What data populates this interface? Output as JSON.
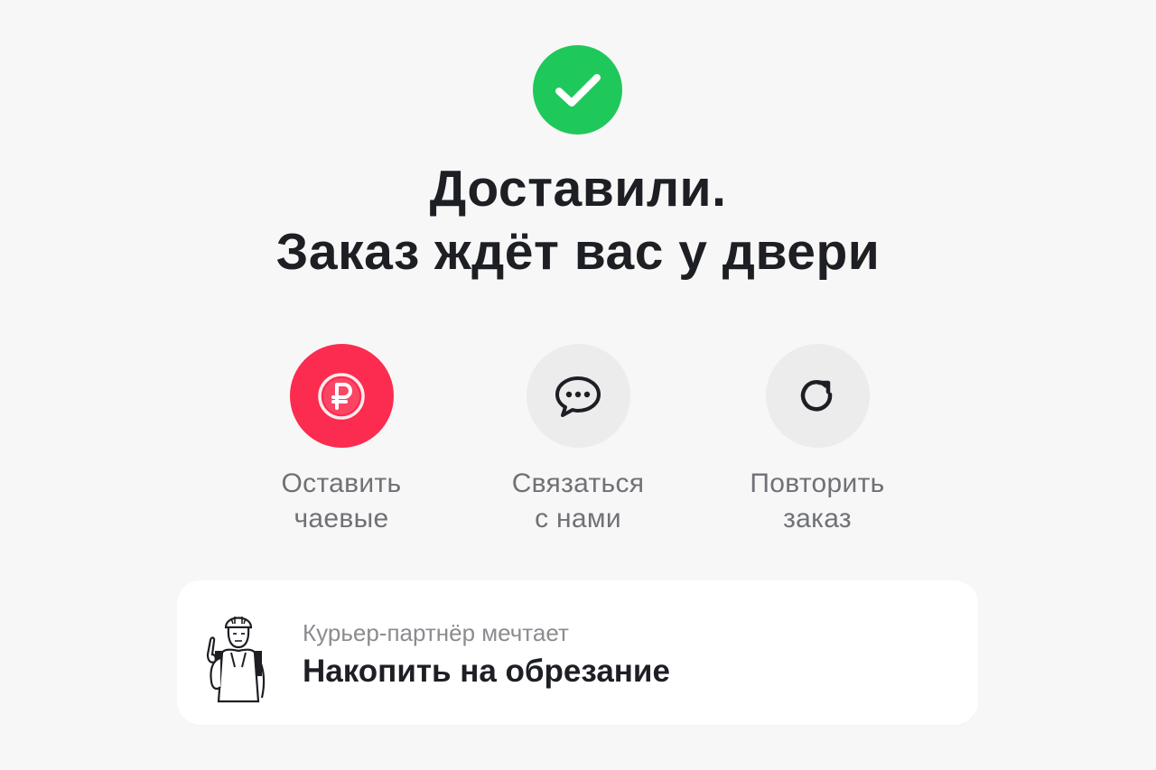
{
  "status": {
    "icon": "checkmark-icon",
    "color": "#1fc85a"
  },
  "headline": {
    "line1": "Доставили.",
    "line2": "Заказ ждёт вас у двери"
  },
  "actions": [
    {
      "icon": "ruble-coin-icon",
      "line1": "Оставить",
      "line2": "чаевые",
      "accent": "#fb2c4f"
    },
    {
      "icon": "chat-bubble-icon",
      "line1": "Связаться",
      "line2": "с нами"
    },
    {
      "icon": "repeat-icon",
      "line1": "Повторить",
      "line2": "заказ"
    }
  ],
  "dream_card": {
    "caption": "Курьер-партнёр мечтает",
    "dream": "Накопить на обрезание",
    "illustration": "courier-illustration"
  }
}
